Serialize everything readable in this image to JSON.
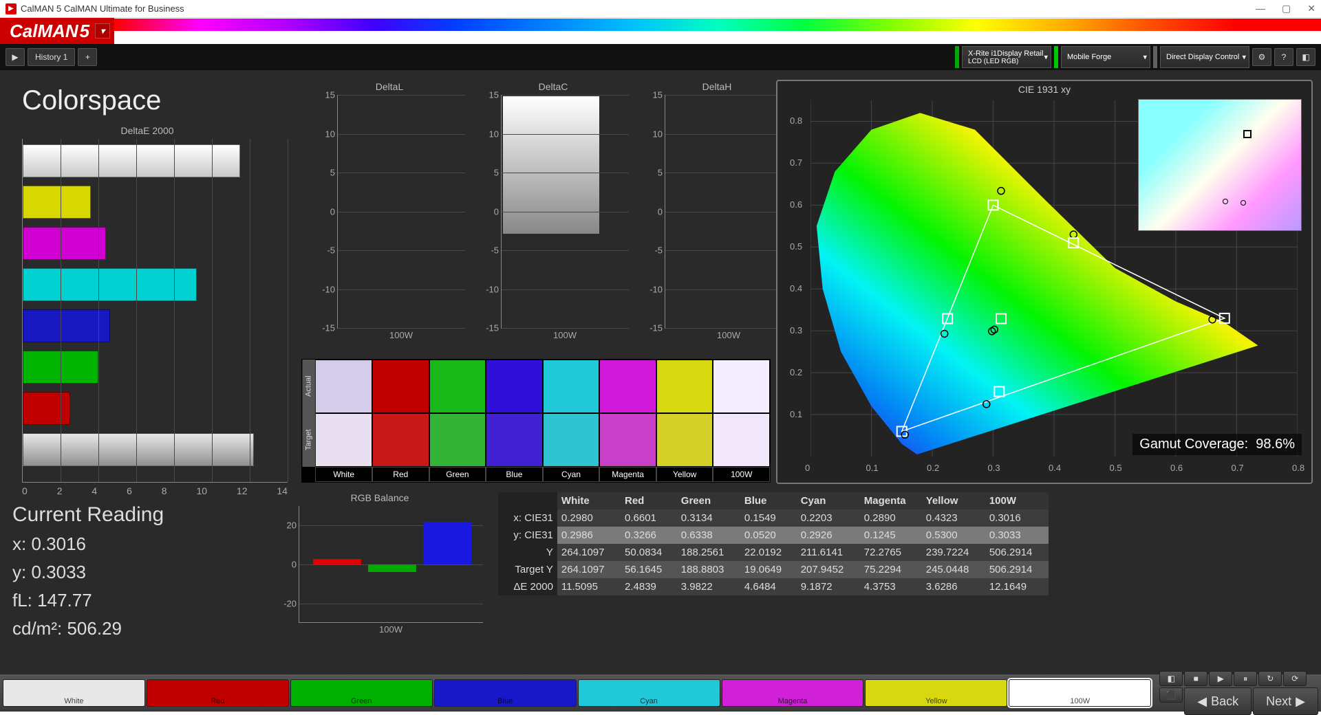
{
  "window": {
    "title": "CalMAN 5 CalMAN Ultimate for Business"
  },
  "brand": {
    "name": "CalMAN",
    "ver": "5"
  },
  "tabs": {
    "history": "History 1"
  },
  "devices": {
    "meter": {
      "line1": "X-Rite i1Display Retail",
      "line2": "LCD (LED RGB)",
      "led": "#00a800"
    },
    "source": {
      "line1": "Mobile Forge",
      "line2": "",
      "led": "#00c800"
    },
    "display": {
      "line1": "Direct Display Control",
      "line2": "",
      "led": "#606060"
    }
  },
  "page_title": "Colorspace",
  "chart_data": {
    "deltaE2000": {
      "type": "bar",
      "title": "DeltaE 2000",
      "xlim": [
        0,
        14
      ],
      "xticks": [
        0,
        2,
        4,
        6,
        8,
        10,
        12,
        14
      ],
      "bars": [
        {
          "name": "White",
          "value": 11.5,
          "fill": "linear-gradient(#ffffff,#c8c8c8)"
        },
        {
          "name": "Yellow",
          "value": 3.6,
          "color": "#d8d800"
        },
        {
          "name": "Magenta",
          "value": 4.4,
          "color": "#d000d0"
        },
        {
          "name": "Cyan",
          "value": 9.2,
          "color": "#00d0d0"
        },
        {
          "name": "Blue",
          "value": 4.6,
          "color": "#1818c0"
        },
        {
          "name": "Green",
          "value": 4.0,
          "color": "#00b400"
        },
        {
          "name": "Red",
          "value": 2.5,
          "color": "#c00000"
        },
        {
          "name": "100W",
          "value": 12.2,
          "fill": "linear-gradient(#e8e8e8,#909090)"
        }
      ]
    },
    "deltaL": {
      "type": "bar",
      "title": "DeltaL",
      "ylim": [
        -15,
        15
      ],
      "yticks": [
        -15,
        -10,
        -5,
        0,
        5,
        10,
        15
      ],
      "xlabel": "100W"
    },
    "deltaC": {
      "type": "bar",
      "title": "DeltaC",
      "ylim": [
        -15,
        15
      ],
      "yticks": [
        -15,
        -10,
        -5,
        0,
        5,
        10,
        15
      ],
      "xlabel": "100W"
    },
    "deltaH": {
      "type": "bar",
      "title": "DeltaH",
      "ylim": [
        -15,
        15
      ],
      "yticks": [
        -15,
        -10,
        -5,
        0,
        5,
        10,
        15
      ],
      "xlabel": "100W"
    },
    "swatches": {
      "rows": [
        "Actual",
        "Target"
      ],
      "cols": [
        {
          "name": "White",
          "actual": "#d4cce8",
          "target": "#e8e0f0"
        },
        {
          "name": "Red",
          "actual": "#c00000",
          "target": "#c81818"
        },
        {
          "name": "Green",
          "actual": "#18b818",
          "target": "#34b434"
        },
        {
          "name": "Blue",
          "actual": "#3010d8",
          "target": "#4020d0"
        },
        {
          "name": "Cyan",
          "actual": "#20c8d8",
          "target": "#30c4d0"
        },
        {
          "name": "Magenta",
          "actual": "#d018d8",
          "target": "#c840c8"
        },
        {
          "name": "Yellow",
          "actual": "#d8d810",
          "target": "#d4d028"
        },
        {
          "name": "100W",
          "actual": "#f4ecff",
          "target": "#f0e8fa"
        }
      ]
    },
    "cie1931": {
      "title": "CIE 1931 xy",
      "xlim": [
        0,
        0.8
      ],
      "ylim": [
        0,
        0.85
      ],
      "xticks": [
        0,
        0.1,
        0.2,
        0.3,
        0.4,
        0.5,
        0.6,
        0.7,
        0.8
      ],
      "yticks": [
        0.1,
        0.2,
        0.3,
        0.4,
        0.5,
        0.6,
        0.7,
        0.8
      ],
      "target_triangle": [
        [
          0.3,
          0.6
        ],
        [
          0.15,
          0.06
        ],
        [
          0.68,
          0.33
        ]
      ],
      "measured_points": [
        {
          "name": "White",
          "x": 0.298,
          "y": 0.299
        },
        {
          "name": "Red",
          "x": 0.66,
          "y": 0.327
        },
        {
          "name": "Green",
          "x": 0.313,
          "y": 0.634
        },
        {
          "name": "Blue",
          "x": 0.155,
          "y": 0.052
        },
        {
          "name": "Cyan",
          "x": 0.22,
          "y": 0.293
        },
        {
          "name": "Magenta",
          "x": 0.289,
          "y": 0.125
        },
        {
          "name": "Yellow",
          "x": 0.432,
          "y": 0.53
        },
        {
          "name": "100W",
          "x": 0.302,
          "y": 0.303
        }
      ],
      "gamut_coverage_label": "Gamut Coverage:",
      "gamut_coverage": "98.6%"
    },
    "rgb_balance": {
      "title": "RGB Balance",
      "ylim": [
        -30,
        30
      ],
      "yticks": [
        -20,
        0,
        20
      ],
      "xlabel": "100W",
      "bars": [
        {
          "name": "R",
          "value": 3,
          "color": "#e00000"
        },
        {
          "name": "G",
          "value": -4,
          "color": "#00a800"
        },
        {
          "name": "B",
          "value": 22,
          "color": "#1818e0"
        }
      ]
    }
  },
  "current_reading": {
    "heading": "Current Reading",
    "x_label": "x:",
    "x": "0.3016",
    "y_label": "y:",
    "y": "0.3033",
    "fL_label": "fL:",
    "fL": "147.77",
    "cdm2_label": "cd/m²:",
    "cdm2": "506.29"
  },
  "data_table": {
    "columns": [
      "",
      "White",
      "Red",
      "Green",
      "Blue",
      "Cyan",
      "Magenta",
      "Yellow",
      "100W"
    ],
    "rows": [
      {
        "label": "x: CIE31",
        "cells": [
          "0.2980",
          "0.6601",
          "0.3134",
          "0.1549",
          "0.2203",
          "0.2890",
          "0.4323",
          "0.3016"
        ]
      },
      {
        "label": "y: CIE31",
        "cells": [
          "0.2986",
          "0.3266",
          "0.6338",
          "0.0520",
          "0.2926",
          "0.1245",
          "0.5300",
          "0.3033"
        ],
        "hl": true
      },
      {
        "label": "Y",
        "cells": [
          "264.1097",
          "50.0834",
          "188.2561",
          "22.0192",
          "211.6141",
          "72.2765",
          "239.7224",
          "506.2914"
        ]
      },
      {
        "label": "Target Y",
        "cells": [
          "264.1097",
          "56.1645",
          "188.8803",
          "19.0649",
          "207.9452",
          "75.2294",
          "245.0448",
          "506.2914"
        ]
      },
      {
        "label": "ΔE 2000",
        "cells": [
          "11.5095",
          "2.4839",
          "3.9822",
          "4.6484",
          "9.1872",
          "4.3753",
          "3.6286",
          "12.1649"
        ]
      }
    ]
  },
  "footer_swatches": [
    {
      "name": "White",
      "color": "#e8e8e8",
      "active": false
    },
    {
      "name": "Red",
      "color": "#c00000",
      "active": false
    },
    {
      "name": "Green",
      "color": "#00b000",
      "active": false
    },
    {
      "name": "Blue",
      "color": "#1818c8",
      "active": false
    },
    {
      "name": "Cyan",
      "color": "#20c8d8",
      "active": false
    },
    {
      "name": "Magenta",
      "color": "#d020d8",
      "active": false
    },
    {
      "name": "Yellow",
      "color": "#d8d810",
      "active": false
    },
    {
      "name": "100W",
      "color": "#ffffff",
      "active": true
    }
  ],
  "footer_nav": {
    "back": "Back",
    "next": "Next"
  }
}
